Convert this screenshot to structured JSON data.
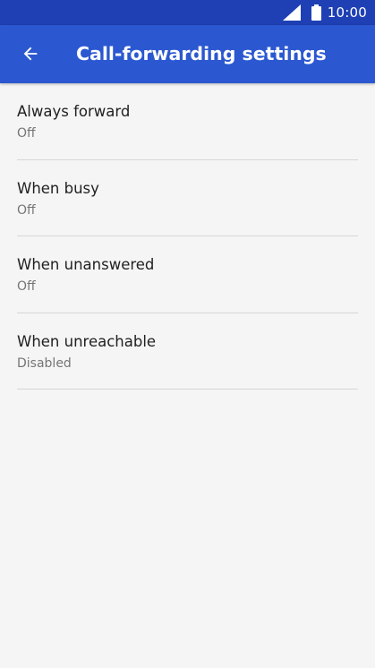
{
  "status_bar": {
    "time": "10:00",
    "icons": [
      "signal-icon",
      "battery-icon"
    ],
    "color": "#1e40b4"
  },
  "app_bar": {
    "title": "Call-forwarding settings",
    "back_icon": "arrow-back-icon",
    "color": "#2b58d1"
  },
  "settings": [
    {
      "title": "Always forward",
      "summary": "Off"
    },
    {
      "title": "When busy",
      "summary": "Off"
    },
    {
      "title": "When unanswered",
      "summary": "Off"
    },
    {
      "title": "When unreachable",
      "summary": "Disabled"
    }
  ]
}
